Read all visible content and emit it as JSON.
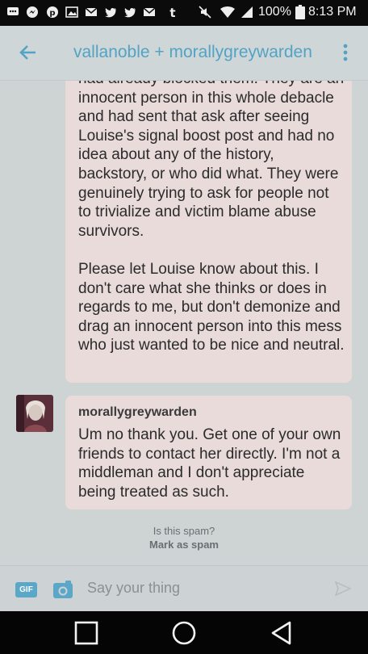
{
  "status_bar": {
    "battery_percent": "100%",
    "time": "8:13 PM",
    "notification_icons": [
      "chat-icon",
      "messenger-icon",
      "pinterest-icon",
      "image-icon",
      "gmail-icon",
      "twitter-icon",
      "twitter-icon",
      "gmail-icon",
      "tumblr-icon"
    ]
  },
  "header": {
    "title": "vallanoble + morallygreywarden"
  },
  "messages": [
    {
      "text": "had already blocked them. They are an innocent person in this whole debacle and had sent that ask after seeing Louise's signal boost post and had no idea about any of the history, backstory, or who did what. They were genuinely trying to ask for people not to trivialize and victim blame abuse survivors.\n\nPlease let Louise know about this. I don't care what she thinks or does in regards to me, but don't demonize and drag an innocent person into this mess who just wanted to be nice and neutral."
    },
    {
      "sender": "morallygreywarden",
      "text": "Um no thank you. Get one of your own friends to contact her directly. I'm not a middleman and I don't appreciate being treated as such."
    }
  ],
  "spam": {
    "question": "Is this spam?",
    "link": "Mark as spam"
  },
  "composer": {
    "gif_label": "GIF",
    "placeholder": "Say your thing"
  },
  "colors": {
    "accent": "#52a3c5",
    "bubble": "#e8dbda",
    "background": "#ced3d4"
  }
}
